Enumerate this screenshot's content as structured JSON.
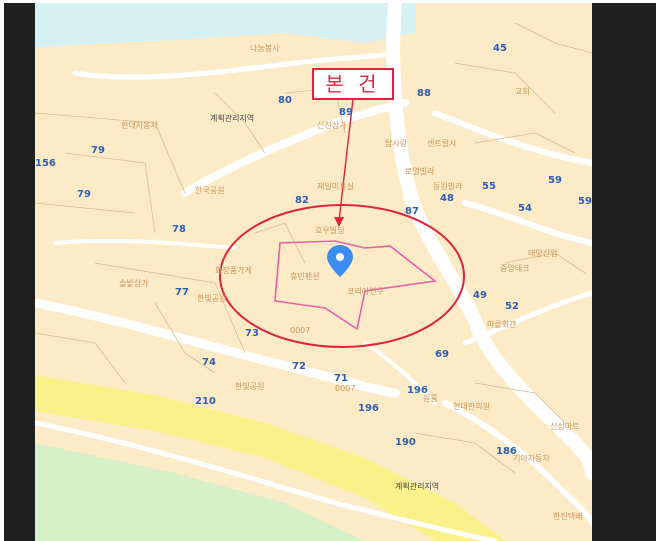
{
  "map": {
    "callout_label": "본 건",
    "zones": [
      "계획관리지역",
      "계획관리지역"
    ],
    "numbers": [
      "45",
      "88",
      "80",
      "89",
      "156",
      "79",
      "79",
      "82",
      "87",
      "48",
      "55",
      "59",
      "54",
      "59",
      "78",
      "77",
      "49",
      "52",
      "73",
      "69",
      "74",
      "72",
      "71",
      "196",
      "210",
      "196",
      "190",
      "186"
    ],
    "poi": [
      "나눔봉사",
      "현대자동차",
      "신진상가",
      "한국공원",
      "탑사랑",
      "센트럴사",
      "로열빌라",
      "동원빌라",
      "제일미용실",
      "호우빌딩",
      "솔밭상가",
      "화장품가게",
      "한빛공원",
      "휴민펜션",
      "코리아연구",
      "태양산업",
      "0007",
      "0007",
      "한빛공원",
      "현대한의원",
      "원룸",
      "교회",
      "중앙테크",
      "마을회관",
      "기아자동차",
      "신성마트",
      "한진택배"
    ],
    "colors": {
      "land": "#fdebc8",
      "road": "#ffffff",
      "water": "#d6f1f4",
      "highway": "#fbf18a",
      "green": "#d7f0c8",
      "highlight_ellipse": "#e0243b",
      "parcel_outline": "#ee5fa7",
      "marker": "#3b8ef0",
      "label_blue": "#2e5fb3"
    },
    "marker_icon": "location-pin-icon"
  }
}
